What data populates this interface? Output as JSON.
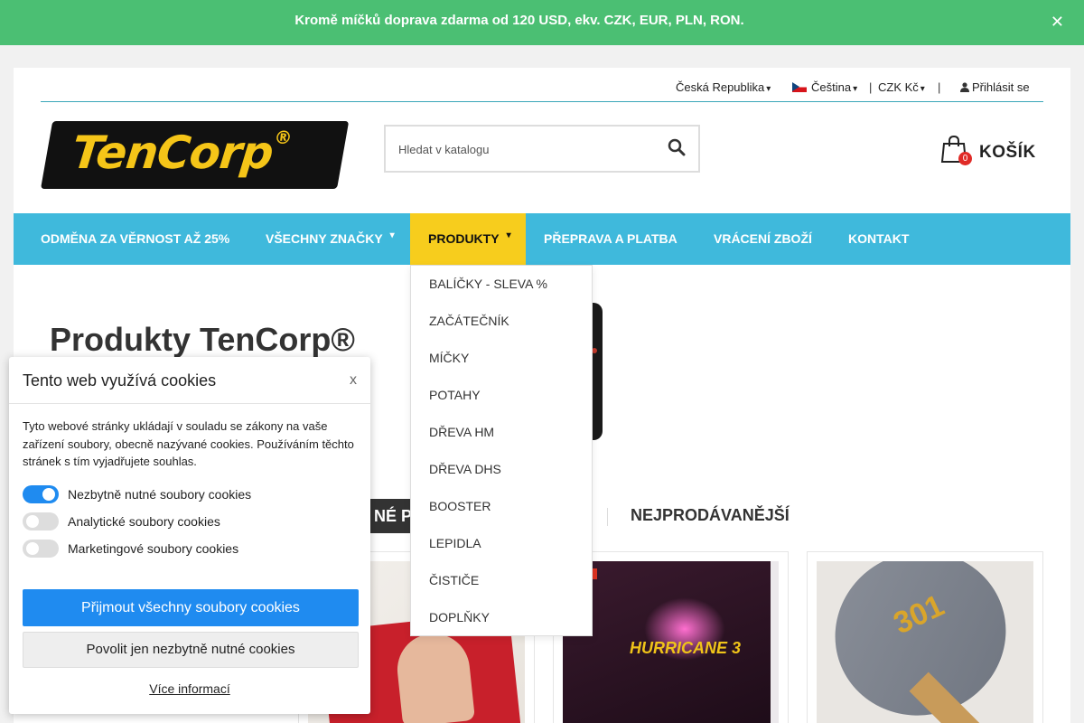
{
  "banner": {
    "text": "Kromě míčků doprava zdarma od 120 USD, ekv. CZK, EUR, PLN, RON.",
    "close": "✕"
  },
  "topbar": {
    "country": "Česká Republika",
    "language": "Čeština",
    "currency": "CZK Kč",
    "login": "Přihlásit se",
    "separator": "|"
  },
  "logo": {
    "text": "TenCorp",
    "mark": "®"
  },
  "search": {
    "placeholder": "Hledat v katalogu"
  },
  "cart": {
    "count": "0",
    "label": "KOŠÍK"
  },
  "nav": {
    "items": [
      {
        "label": "ODMĚNA ZA VĚRNOST AŽ 25%"
      },
      {
        "label": "VŠECHNY ZNAČKY"
      },
      {
        "label": "PRODUKTY"
      },
      {
        "label": "PŘEPRAVA A PLATBA"
      },
      {
        "label": "VRÁCENÍ ZBOŽÍ"
      },
      {
        "label": "KONTAKT"
      }
    ]
  },
  "dropdown": {
    "items": [
      "BALÍČKY - SLEVA %",
      "ZAČÁTEČNÍK",
      "MÍČKY",
      "POTAHY",
      "DŘEVA HM",
      "DŘEVA DHS",
      "BOOSTER",
      "LEPIDLA",
      "ČISTIČE",
      "DOPLŇKY"
    ]
  },
  "hero": {
    "title": "Produkty TenCorp®"
  },
  "tabs": {
    "partial": "NÉ PR",
    "bestsellers": "NEJPRODÁVANĚJŠÍ"
  },
  "cards": {
    "hurricane_text": "HURRICANE 3",
    "blade_text": "301"
  },
  "cookie": {
    "title": "Tento web využívá cookies",
    "close": "x",
    "text": "Tyto webové stránky ukládají v souladu se zákony na vaše zařízení soubory, obecně nazývané cookies. Používáním těchto stránek s tím vyjadřujete souhlas.",
    "toggles": [
      {
        "label": "Nezbytně nutné soubory cookies",
        "on": true
      },
      {
        "label": "Analytické soubory cookies",
        "on": false
      },
      {
        "label": "Marketingové soubory cookies",
        "on": false
      }
    ],
    "accept_all": "Přijmout všechny soubory cookies",
    "necessary_only": "Povolit jen nezbytně nutné cookies",
    "more_info": "Více informací"
  },
  "colors": {
    "banner": "#4bbf73",
    "nav": "#3fb9dc",
    "nav_active": "#f7cd1d",
    "accent_blue": "#1f8bf0"
  }
}
